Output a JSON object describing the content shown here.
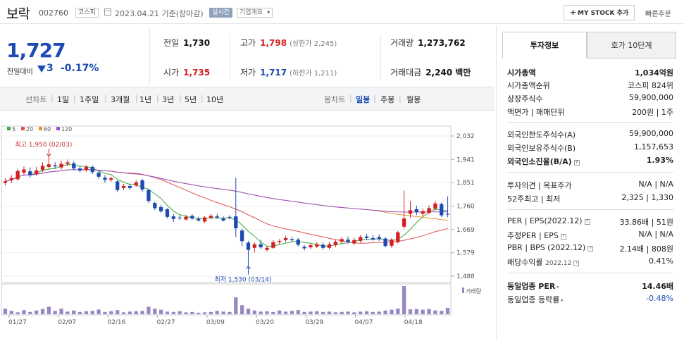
{
  "header": {
    "name": "보락",
    "code": "002760",
    "market": "코스피",
    "date": "2023.04.21 기준(장마감)",
    "live_label": "실시간",
    "overview_label": "기업개요",
    "mystock_label": "MY STOCK 추가",
    "quick_order_label": "빠른주문"
  },
  "price": {
    "current": "1,727",
    "change_label": "전일대비",
    "change": "3",
    "change_rate": "-0.17%",
    "direction": "down",
    "down_color": "#1d4bb3",
    "up_color": "#d42020"
  },
  "stats": {
    "prev": {
      "label": "전일",
      "value": "1,730"
    },
    "high": {
      "label": "고가",
      "value": "1,798",
      "sub": "(상한가 2,245)"
    },
    "volume": {
      "label": "거래량",
      "value": "1,273,762"
    },
    "open": {
      "label": "시가",
      "value": "1,735"
    },
    "low": {
      "label": "저가",
      "value": "1,717",
      "sub": "(하한가 1,211)"
    },
    "amount": {
      "label": "거래대금",
      "value": "2,240 백만"
    }
  },
  "period_bar": {
    "line_chart": "선차트",
    "periods": [
      "1일",
      "1주일",
      "3개월",
      "1년",
      "3년",
      "5년",
      "10년"
    ],
    "candle_chart": "봉차트",
    "candle_periods": [
      "일봉",
      "주봉",
      "월봉"
    ],
    "active": "일봉"
  },
  "chart_data": {
    "type": "candlestick",
    "ma_legend": [
      {
        "label": "5",
        "color": "#3ea63e"
      },
      {
        "label": "20",
        "color": "#e05050"
      },
      {
        "label": "60",
        "color": "#e89030"
      },
      {
        "label": "120",
        "color": "#9a50c8"
      }
    ],
    "y_ticks": [
      2032,
      1941,
      1851,
      1760,
      1669,
      1579,
      1488
    ],
    "ylim": [
      1488,
      2032
    ],
    "x_labels": [
      "01/27",
      "02/07",
      "02/16",
      "02/27",
      "03/09",
      "03/20",
      "03/29",
      "04/07",
      "04/18"
    ],
    "high_annotation": "최고 1,950 (02/03)",
    "low_annotation": "최저 1,530 (03/14)",
    "volume_label": "거래량",
    "candles": [
      {
        "o": 1850,
        "c": 1856,
        "h": 1868,
        "l": 1840
      },
      {
        "o": 1860,
        "c": 1868,
        "h": 1880,
        "l": 1850
      },
      {
        "o": 1864,
        "c": 1896,
        "h": 1904,
        "l": 1858
      },
      {
        "o": 1890,
        "c": 1902,
        "h": 1914,
        "l": 1880
      },
      {
        "o": 1895,
        "c": 1880,
        "h": 1910,
        "l": 1870
      },
      {
        "o": 1885,
        "c": 1898,
        "h": 1912,
        "l": 1878
      },
      {
        "o": 1900,
        "c": 1916,
        "h": 1930,
        "l": 1892
      },
      {
        "o": 1912,
        "c": 1922,
        "h": 1950,
        "l": 1905
      },
      {
        "o": 1918,
        "c": 1914,
        "h": 1930,
        "l": 1904
      },
      {
        "o": 1910,
        "c": 1924,
        "h": 1936,
        "l": 1902
      },
      {
        "o": 1924,
        "c": 1930,
        "h": 1940,
        "l": 1915
      },
      {
        "o": 1926,
        "c": 1906,
        "h": 1934,
        "l": 1900
      },
      {
        "o": 1906,
        "c": 1898,
        "h": 1916,
        "l": 1890
      },
      {
        "o": 1900,
        "c": 1912,
        "h": 1920,
        "l": 1892
      },
      {
        "o": 1912,
        "c": 1892,
        "h": 1918,
        "l": 1885
      },
      {
        "o": 1890,
        "c": 1874,
        "h": 1898,
        "l": 1866
      },
      {
        "o": 1870,
        "c": 1862,
        "h": 1880,
        "l": 1850
      },
      {
        "o": 1862,
        "c": 1868,
        "h": 1874,
        "l": 1855
      },
      {
        "o": 1856,
        "c": 1822,
        "h": 1860,
        "l": 1815
      },
      {
        "o": 1830,
        "c": 1838,
        "h": 1846,
        "l": 1822
      },
      {
        "o": 1838,
        "c": 1830,
        "h": 1848,
        "l": 1822
      },
      {
        "o": 1840,
        "c": 1852,
        "h": 1860,
        "l": 1834
      },
      {
        "o": 1860,
        "c": 1824,
        "h": 1866,
        "l": 1815
      },
      {
        "o": 1822,
        "c": 1780,
        "h": 1828,
        "l": 1772
      },
      {
        "o": 1772,
        "c": 1752,
        "h": 1778,
        "l": 1745
      },
      {
        "o": 1756,
        "c": 1740,
        "h": 1764,
        "l": 1734
      },
      {
        "o": 1748,
        "c": 1718,
        "h": 1752,
        "l": 1712
      },
      {
        "o": 1720,
        "c": 1710,
        "h": 1730,
        "l": 1698
      },
      {
        "o": 1716,
        "c": 1714,
        "h": 1724,
        "l": 1706
      },
      {
        "o": 1708,
        "c": 1718,
        "h": 1726,
        "l": 1704
      },
      {
        "o": 1722,
        "c": 1712,
        "h": 1728,
        "l": 1706
      },
      {
        "o": 1710,
        "c": 1704,
        "h": 1718,
        "l": 1700
      },
      {
        "o": 1700,
        "c": 1716,
        "h": 1722,
        "l": 1694
      },
      {
        "o": 1715,
        "c": 1722,
        "h": 1730,
        "l": 1708
      },
      {
        "o": 1720,
        "c": 1716,
        "h": 1730,
        "l": 1710
      },
      {
        "o": 1712,
        "c": 1704,
        "h": 1720,
        "l": 1700
      },
      {
        "o": 1718,
        "c": 1716,
        "h": 1724,
        "l": 1708
      },
      {
        "o": 1720,
        "c": 1674,
        "h": 1870,
        "l": 1640
      },
      {
        "o": 1665,
        "c": 1624,
        "h": 1672,
        "l": 1605
      },
      {
        "o": 1618,
        "c": 1590,
        "h": 1625,
        "l": 1530
      },
      {
        "o": 1598,
        "c": 1612,
        "h": 1620,
        "l": 1580
      },
      {
        "o": 1612,
        "c": 1600,
        "h": 1630,
        "l": 1594
      },
      {
        "o": 1590,
        "c": 1598,
        "h": 1605,
        "l": 1584
      },
      {
        "o": 1598,
        "c": 1620,
        "h": 1628,
        "l": 1594
      },
      {
        "o": 1620,
        "c": 1624,
        "h": 1632,
        "l": 1612
      },
      {
        "o": 1628,
        "c": 1636,
        "h": 1645,
        "l": 1620
      },
      {
        "o": 1632,
        "c": 1628,
        "h": 1640,
        "l": 1622
      },
      {
        "o": 1630,
        "c": 1610,
        "h": 1636,
        "l": 1603
      },
      {
        "o": 1602,
        "c": 1596,
        "h": 1608,
        "l": 1588
      },
      {
        "o": 1600,
        "c": 1608,
        "h": 1614,
        "l": 1594
      },
      {
        "o": 1603,
        "c": 1612,
        "h": 1620,
        "l": 1597
      },
      {
        "o": 1610,
        "c": 1598,
        "h": 1618,
        "l": 1590
      },
      {
        "o": 1598,
        "c": 1612,
        "h": 1620,
        "l": 1592
      },
      {
        "o": 1608,
        "c": 1622,
        "h": 1630,
        "l": 1600
      },
      {
        "o": 1622,
        "c": 1632,
        "h": 1640,
        "l": 1615
      },
      {
        "o": 1630,
        "c": 1622,
        "h": 1642,
        "l": 1615
      },
      {
        "o": 1615,
        "c": 1628,
        "h": 1636,
        "l": 1608
      },
      {
        "o": 1625,
        "c": 1640,
        "h": 1648,
        "l": 1618
      },
      {
        "o": 1642,
        "c": 1636,
        "h": 1652,
        "l": 1628
      },
      {
        "o": 1636,
        "c": 1630,
        "h": 1648,
        "l": 1626
      },
      {
        "o": 1640,
        "c": 1632,
        "h": 1650,
        "l": 1625
      },
      {
        "o": 1634,
        "c": 1605,
        "h": 1640,
        "l": 1600
      },
      {
        "o": 1606,
        "c": 1630,
        "h": 1636,
        "l": 1598
      },
      {
        "o": 1620,
        "c": 1658,
        "h": 1664,
        "l": 1615
      },
      {
        "o": 1680,
        "c": 1712,
        "h": 1820,
        "l": 1672
      },
      {
        "o": 1730,
        "c": 1744,
        "h": 1780,
        "l": 1715
      },
      {
        "o": 1748,
        "c": 1736,
        "h": 1762,
        "l": 1725
      },
      {
        "o": 1730,
        "c": 1740,
        "h": 1750,
        "l": 1720
      },
      {
        "o": 1734,
        "c": 1752,
        "h": 1762,
        "l": 1728
      },
      {
        "o": 1750,
        "c": 1770,
        "h": 1780,
        "l": 1742
      },
      {
        "o": 1768,
        "c": 1724,
        "h": 1774,
        "l": 1718
      },
      {
        "o": 1730,
        "c": 1727,
        "h": 1798,
        "l": 1717
      }
    ],
    "volumes": [
      30,
      18,
      10,
      22,
      12,
      20,
      28,
      40,
      18,
      30,
      14,
      20,
      12,
      16,
      18,
      25,
      12,
      16,
      22,
      10,
      14,
      16,
      18,
      40,
      30,
      24,
      14,
      12,
      16,
      10,
      12,
      8,
      10,
      12,
      18,
      14,
      12,
      90,
      48,
      30,
      20,
      14,
      16,
      12,
      20,
      14,
      18,
      22,
      12,
      14,
      16,
      12,
      14,
      10,
      12,
      14,
      10,
      14,
      16,
      12,
      14,
      20,
      24,
      30,
      150,
      26,
      28,
      24,
      28,
      20,
      18,
      34
    ]
  },
  "panel": {
    "tab_invest": "투자정보",
    "tab_quote": "호가 10단계",
    "market_cap": {
      "label": "시가총액",
      "value": "1,034억원"
    },
    "cap_rank": {
      "label": "시가총액순위",
      "value": "코스피  824위"
    },
    "shares": {
      "label": "상장주식수",
      "value": "59,900,000"
    },
    "par": {
      "label": "액면가 | 매매단위",
      "value": "200원 | 1주"
    },
    "foreign_limit": {
      "label": "외국인한도주식수(A)",
      "value": "59,900,000"
    },
    "foreign_hold": {
      "label": "외국인보유주식수(B)",
      "value": "1,157,653"
    },
    "foreign_ratio": {
      "label": "외국인소진율(B/A)",
      "value": "1.93%"
    },
    "opinion": {
      "label": "투자의견 | 목표주가",
      "value": "N/A | N/A"
    },
    "week52": {
      "label": "52주최고 | 최저",
      "value": "2,325 | 1,330"
    },
    "per": {
      "label": "PER | EPS(2022.12)",
      "value": "33.86배 | 51원"
    },
    "est_per": {
      "label": "추정PER | EPS",
      "value": "N/A | N/A"
    },
    "pbr": {
      "label": "PBR | BPS (2022.12)",
      "value": "2.14배 | 808원"
    },
    "div": {
      "label": "배당수익률",
      "sub": "2022.12",
      "value": "0.41%"
    },
    "ind_per": {
      "label": "동일업종 PER",
      "value": "14.46배"
    },
    "ind_rate": {
      "label": "동일업종 등락률",
      "value": "-0.48%"
    }
  }
}
